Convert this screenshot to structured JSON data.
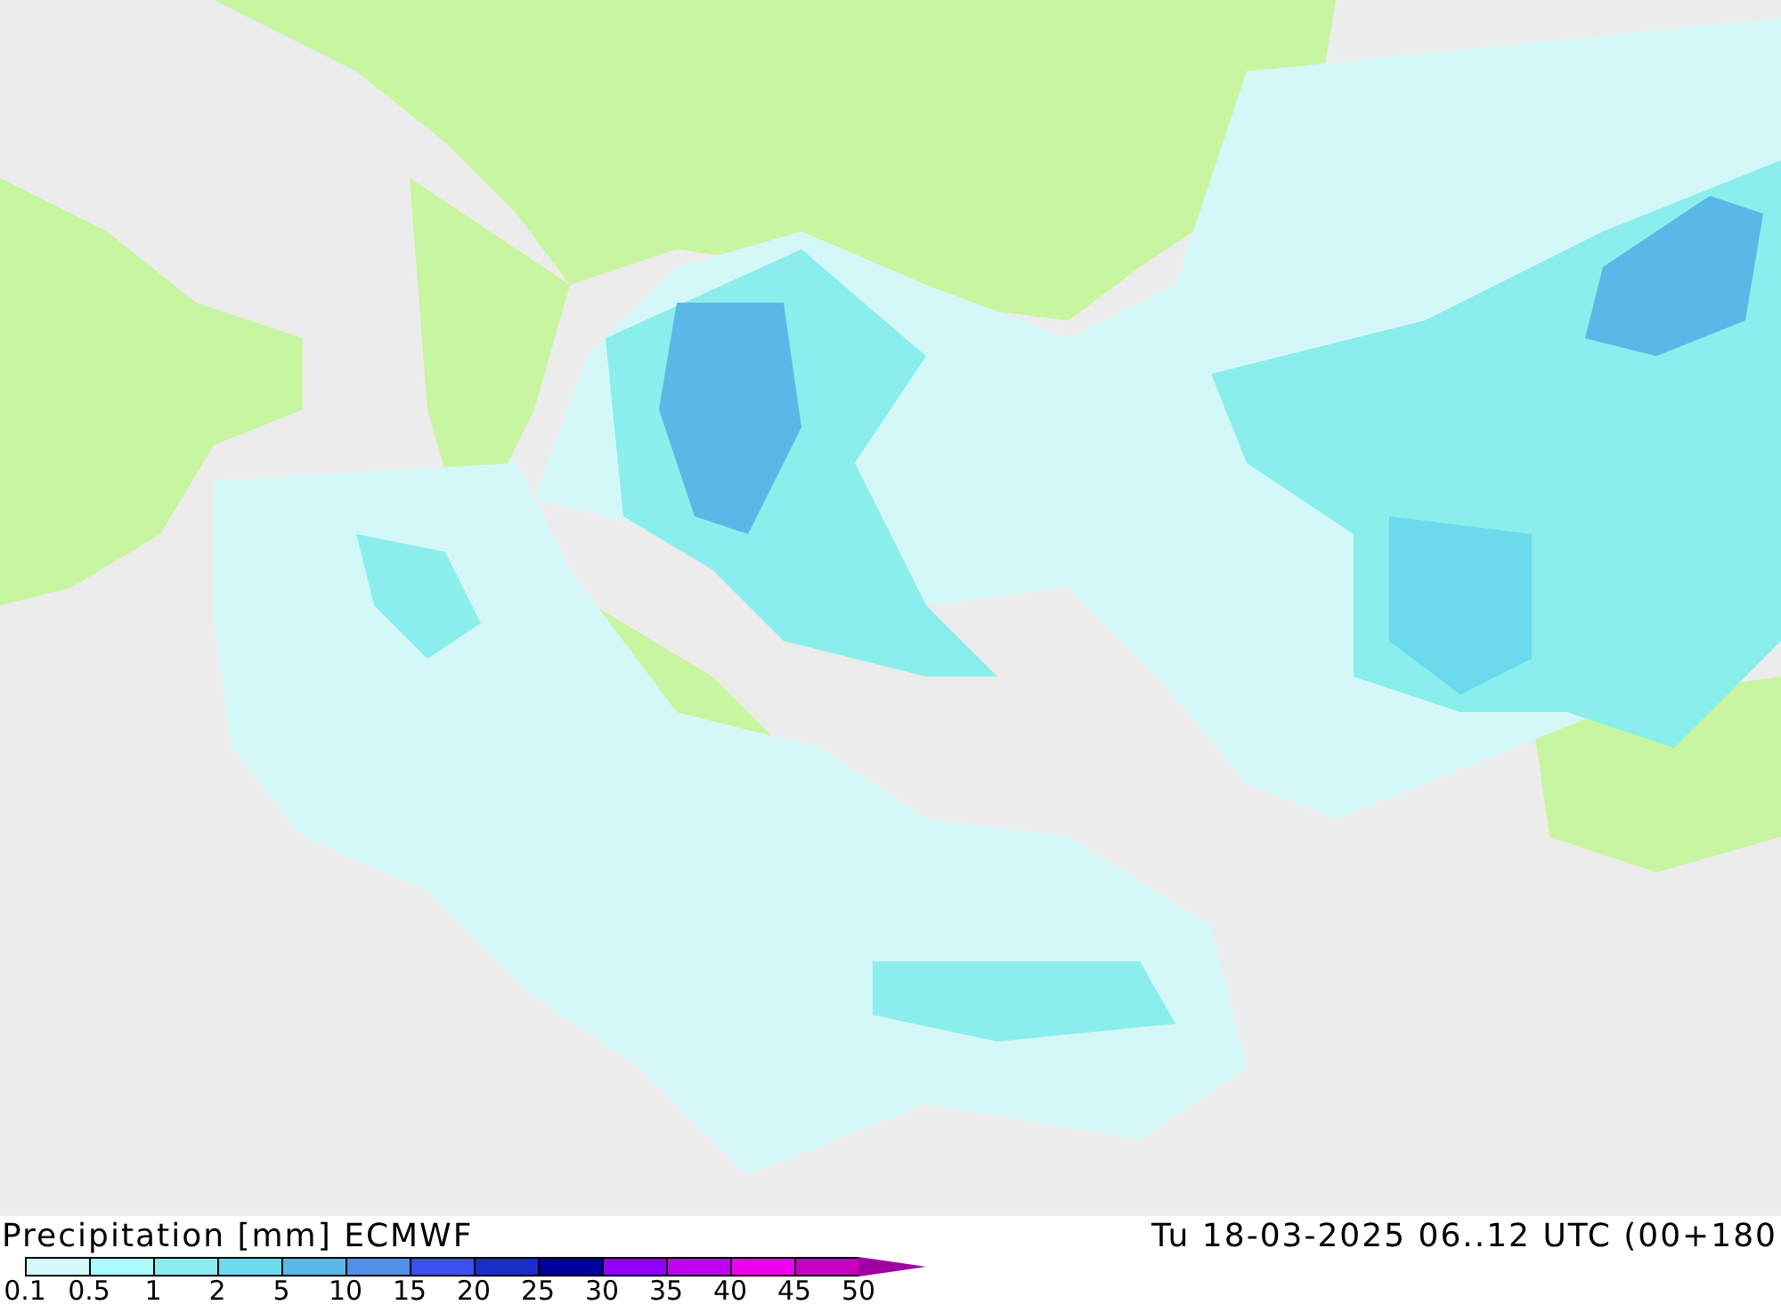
{
  "title": "Precipitation [mm] ECMWF",
  "valid_time": "Tu 18-03-2025 06..12 UTC (00+180",
  "legend": {
    "segments": [
      {
        "color": "#d2f8f8"
      },
      {
        "color": "#aafcfc"
      },
      {
        "color": "#8aeeec"
      },
      {
        "color": "#6adaec"
      },
      {
        "color": "#5ab8e8"
      },
      {
        "color": "#5090e8"
      },
      {
        "color": "#3c50f0"
      },
      {
        "color": "#1c2cc8"
      },
      {
        "color": "#0000a0"
      },
      {
        "color": "#9000f8"
      },
      {
        "color": "#c000f0"
      },
      {
        "color": "#f000f0"
      },
      {
        "color": "#c800c0"
      },
      {
        "kind": "arrow",
        "color": "#a000a0"
      }
    ],
    "ticks": [
      "0.1",
      "0.5",
      "1",
      "2",
      "5",
      "10",
      "15",
      "20",
      "25",
      "30",
      "35",
      "40",
      "45",
      "50"
    ]
  }
}
